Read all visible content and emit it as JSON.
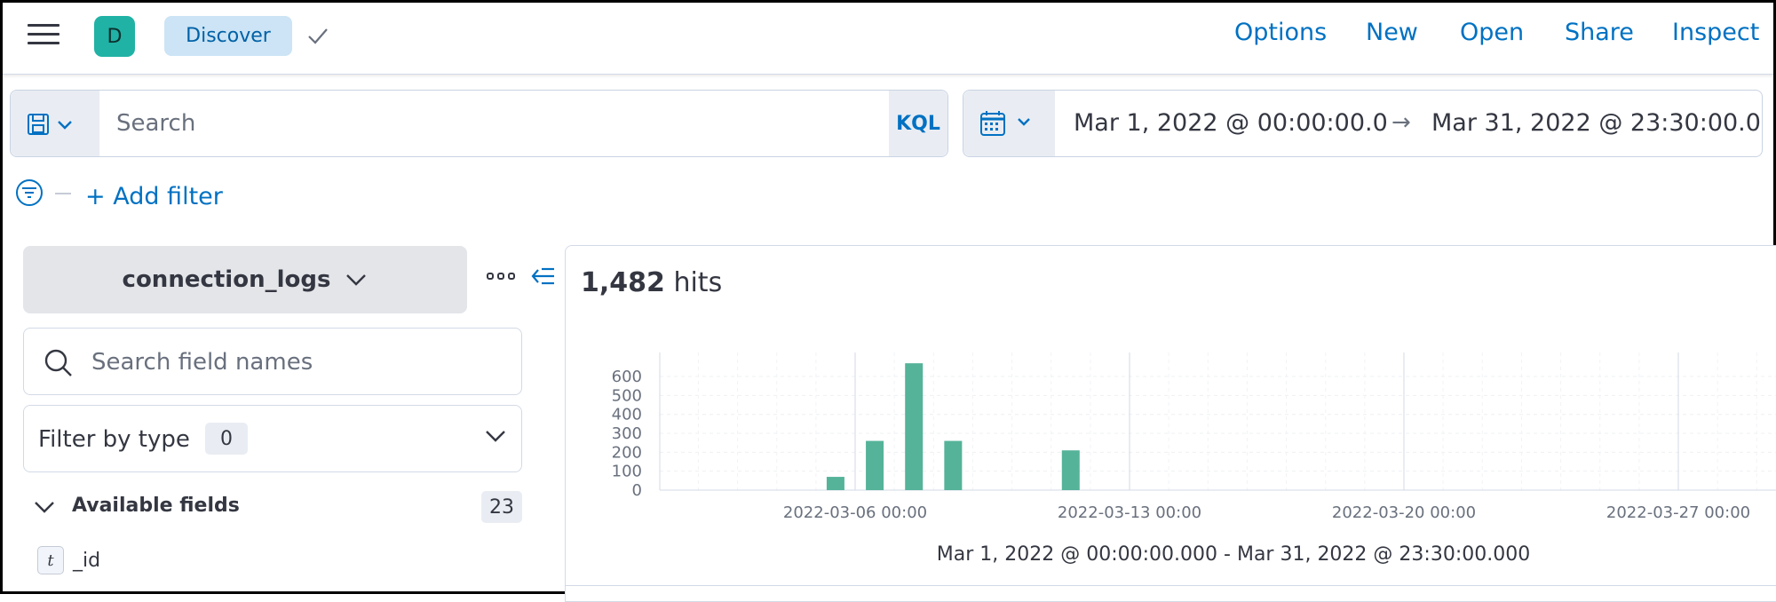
{
  "header": {
    "menu_icon": "hamburger-icon",
    "avatar_letter": "D",
    "avatar_color": "#20b2a5",
    "breadcrumb": "Discover",
    "nav": [
      "Options",
      "New",
      "Open",
      "Share",
      "Inspect"
    ],
    "link_color": "#0071c2"
  },
  "query": {
    "placeholder": "Search",
    "language": "KQL",
    "save_icon": "save-icon"
  },
  "date": {
    "start": "Mar 1, 2022 @ 00:00:00.0",
    "arrow": "→",
    "end": "Mar 31, 2022 @ 23:30:00.0",
    "icon": "calendar-icon"
  },
  "filters": {
    "add_label": "+ Add filter",
    "icon": "filter-icon"
  },
  "sidebar": {
    "index_pattern": "connection_logs",
    "search_placeholder": "Search field names",
    "filter_type_label": "Filter by type",
    "filter_type_count": "0",
    "available_label": "Available fields",
    "available_count": "23",
    "fields": [
      {
        "type": "t",
        "name": "_id"
      }
    ]
  },
  "main": {
    "hit_count": "1,482",
    "hit_label": "hits"
  },
  "chart_data": {
    "type": "bar",
    "bar_color": "#54b399",
    "x": [
      "2022-03-05",
      "2022-03-06",
      "2022-03-07",
      "2022-03-08",
      "2022-03-09",
      "2022-03-10",
      "2022-03-11",
      "2022-03-12"
    ],
    "values": [
      70,
      260,
      670,
      260,
      0,
      0,
      210,
      0
    ],
    "x_ticks": [
      "2022-03-06 00:00",
      "2022-03-13 00:00",
      "2022-03-20 00:00",
      "2022-03-27 00:00"
    ],
    "y_ticks": [
      0,
      100,
      200,
      300,
      400,
      500,
      600
    ],
    "ylim": [
      0,
      680
    ],
    "xlabel": "Mar 1, 2022 @ 00:00:00.000 - Mar 31, 2022 @ 23:30:00.000",
    "grid": true
  }
}
